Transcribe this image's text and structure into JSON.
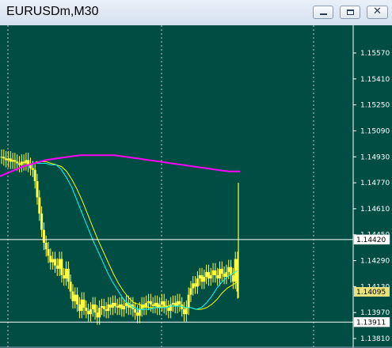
{
  "window": {
    "title": "EURUSDm,M30",
    "minimize_icon": "minimize-icon",
    "maximize_icon": "maximize-icon",
    "close_icon": "close-icon"
  },
  "chart_data": {
    "type": "candlestick",
    "symbol": "EURUSDm",
    "timeframe": "M30",
    "ylim": [
      1.1381,
      1.1567
    ],
    "y_ticks": [
      "1.15570",
      "1.15410",
      "1.15250",
      "1.15090",
      "1.14930",
      "1.14770",
      "1.14610",
      "1.14450",
      "1.14290",
      "1.14130",
      "1.13970",
      "1.13810"
    ],
    "price_lines": [
      {
        "label": "1.14420",
        "value": 1.1442
      },
      {
        "label": "1.13911",
        "value": 1.13911
      }
    ],
    "bid_label": "1.14095",
    "grid": true,
    "colors": {
      "background": "#004d44",
      "candle": "#ffff44",
      "ma_fast": "#00ffff",
      "ma_slow": "#ffff00",
      "ma_long": "#ff00ff",
      "grid": "#c8c8c8",
      "price_line": "#ffffff",
      "bid_label_bg": "#e8e27a"
    },
    "series": [
      {
        "name": "close",
        "values": [
          1.1493,
          1.1492,
          1.1491,
          1.1492,
          1.149,
          1.1491,
          1.149,
          1.1489,
          1.1488,
          1.149,
          1.1489,
          1.1491,
          1.1488,
          1.1486,
          1.1485,
          1.1478,
          1.1468,
          1.1458,
          1.1448,
          1.144,
          1.1436,
          1.1432,
          1.1428,
          1.143,
          1.1426,
          1.1424,
          1.143,
          1.142,
          1.1418,
          1.1424,
          1.1416,
          1.141,
          1.1404,
          1.1408,
          1.1402,
          1.1398,
          1.1405,
          1.14,
          1.1398,
          1.1396,
          1.1399,
          1.1402,
          1.1397,
          1.1394,
          1.14,
          1.1401,
          1.1399,
          1.1398,
          1.1402,
          1.14,
          1.1403,
          1.1401,
          1.14,
          1.1402,
          1.1399,
          1.1401,
          1.1403,
          1.14,
          1.1402,
          1.1399,
          1.1397,
          1.1395,
          1.1399,
          1.1402,
          1.14,
          1.1403,
          1.1404,
          1.1402,
          1.1401,
          1.1403,
          1.14,
          1.1402,
          1.1404,
          1.1401,
          1.14,
          1.1398,
          1.1402,
          1.1403,
          1.1401,
          1.1404,
          1.1402,
          1.1399,
          1.1396,
          1.14,
          1.1408,
          1.1412,
          1.1415,
          1.1413,
          1.1418,
          1.142,
          1.1416,
          1.1419,
          1.1422,
          1.1418,
          1.142,
          1.1423,
          1.142,
          1.1418,
          1.1424,
          1.1421,
          1.1419,
          1.1422,
          1.1425,
          1.142,
          1.1416,
          1.143,
          1.141
        ]
      },
      {
        "name": "ma_fast",
        "values": [
          1.1489,
          1.1489,
          1.1489,
          1.1488,
          1.1488,
          1.1485,
          1.148,
          1.1474,
          1.1466,
          1.1458,
          1.145,
          1.1442,
          1.1435,
          1.1428,
          1.1421,
          1.1415,
          1.141,
          1.1405,
          1.1402,
          1.14,
          1.1399,
          1.1399,
          1.1399,
          1.14,
          1.14,
          1.14,
          1.1401,
          1.1401,
          1.1401,
          1.14,
          1.14,
          1.1399,
          1.14,
          1.1403,
          1.1407,
          1.1412,
          1.1416,
          1.1419,
          1.1421,
          1.1423
        ]
      },
      {
        "name": "ma_slow",
        "values": [
          1.149,
          1.149,
          1.149,
          1.1489,
          1.1488,
          1.1487,
          1.1484,
          1.1479,
          1.1473,
          1.1466,
          1.1458,
          1.145,
          1.1442,
          1.1435,
          1.1428,
          1.1421,
          1.1415,
          1.141,
          1.1406,
          1.1403,
          1.1402,
          1.1401,
          1.14,
          1.14,
          1.14,
          1.1401,
          1.1401,
          1.1401,
          1.1401,
          1.14,
          1.14,
          1.1399,
          1.1399,
          1.14,
          1.1402,
          1.1405,
          1.1409,
          1.1412,
          1.1414,
          1.1416
        ]
      },
      {
        "name": "ma_long",
        "values": [
          1.1481,
          1.1484,
          1.1487,
          1.1489,
          1.1491,
          1.1492,
          1.1493,
          1.1494,
          1.1494,
          1.1494,
          1.1494,
          1.1493,
          1.1492,
          1.1491,
          1.149,
          1.1489,
          1.1488,
          1.1487,
          1.1486,
          1.1485,
          1.1484,
          1.1484
        ]
      }
    ],
    "last_high": 1.1477,
    "last_low": 1.1406
  }
}
